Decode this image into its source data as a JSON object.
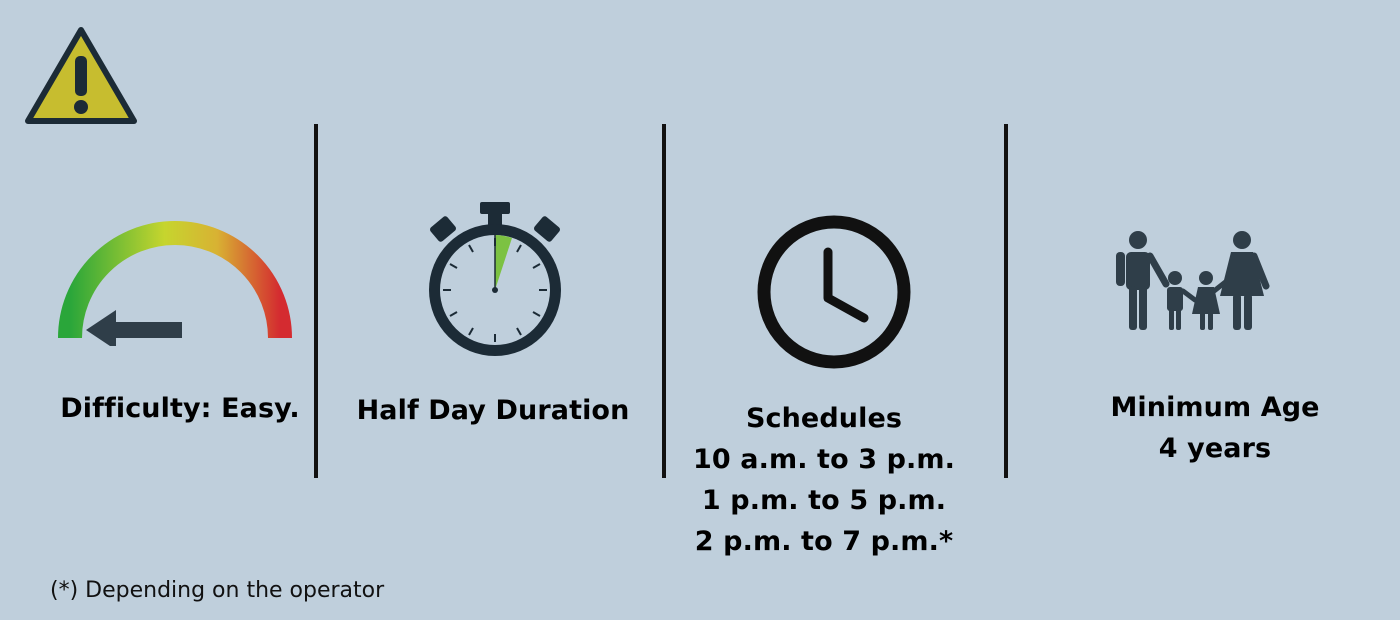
{
  "difficulty": {
    "label": "Difficulty: Easy."
  },
  "duration": {
    "label": "Half Day Duration"
  },
  "schedules": {
    "title": "Schedules",
    "times": [
      "10 a.m. to 3 p.m.",
      "1 p.m. to 5 p.m.",
      "2 p.m. to 7 p.m.*"
    ]
  },
  "minimum_age": {
    "title": "Minimum Age",
    "value": "4 years"
  },
  "footnote": "(*) Depending on the operator",
  "colors": {
    "background": "#bfcfdc",
    "icon_dark": "#1c2b36",
    "warning_yellow": "#c7bd2f",
    "gauge_green": "#2aa63a",
    "gauge_yellow": "#c6d52e",
    "gauge_red": "#d42b30",
    "stopwatch_green": "#7cc242"
  },
  "icons": [
    "warning-icon",
    "difficulty-gauge-icon",
    "stopwatch-icon",
    "clock-icon",
    "family-icon"
  ]
}
